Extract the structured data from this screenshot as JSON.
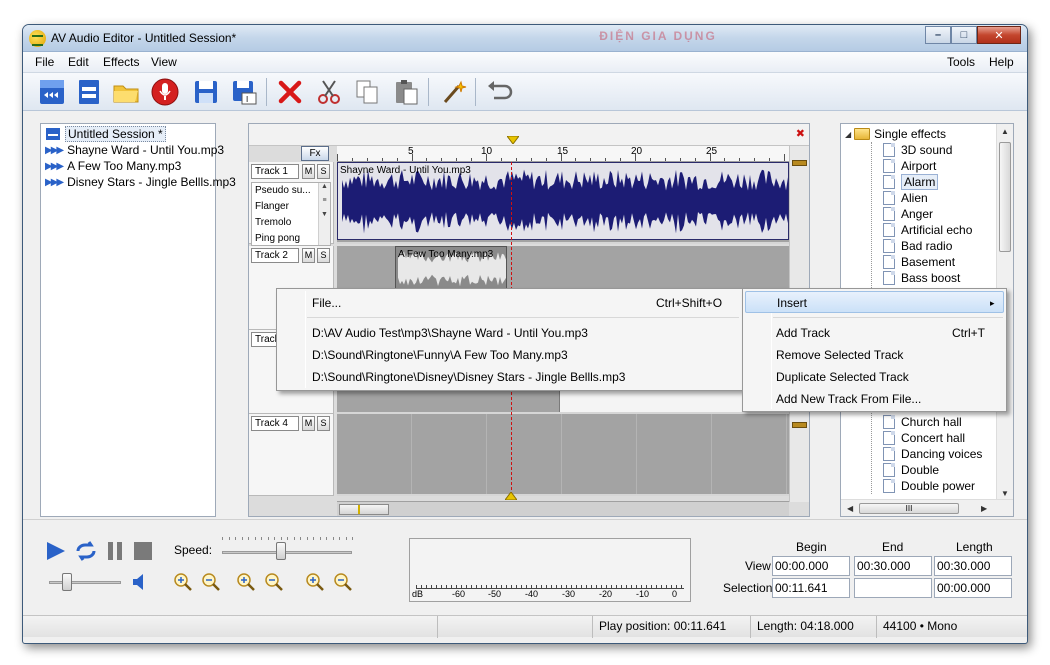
{
  "window": {
    "title": "AV Audio Editor - Untitled Session*",
    "watermark": "ĐIỆN GIA DỤNG",
    "controls": {
      "minimize": "–",
      "maximize": "□",
      "close": "✕"
    }
  },
  "menubar": {
    "left": [
      "File",
      "Edit",
      "Effects",
      "View"
    ],
    "right": [
      "Tools",
      "Help"
    ]
  },
  "toolbar": {
    "icons": [
      "new-session-icon",
      "new-file-icon",
      "open-folder-icon",
      "record-icon",
      "save-icon",
      "save-as-icon",
      "delete-icon",
      "cut-icon",
      "copy-icon",
      "paste-icon",
      "magic-wand-icon",
      "undo-icon"
    ]
  },
  "session": {
    "items": [
      {
        "label": "Untitled Session *",
        "type": "session"
      },
      {
        "label": "Shayne Ward -  Until You.mp3",
        "type": "file"
      },
      {
        "label": "A Few Too Many.mp3",
        "type": "file"
      },
      {
        "label": "Disney Stars - Jingle Bellls.mp3",
        "type": "file"
      }
    ]
  },
  "editor": {
    "fx_label": "Fx",
    "close_glyph": "✖",
    "ruler_ticks": [
      "5",
      "10",
      "15",
      "20",
      "25"
    ],
    "tracks": [
      {
        "label": "Track 1",
        "mute": "M",
        "solo": "S",
        "clip": "Shayne Ward -  Until You.mp3",
        "effects": [
          "Pseudo su...",
          "Flanger",
          "Tremolo",
          "Ping pong"
        ]
      },
      {
        "label": "Track 2",
        "mute": "M",
        "solo": "S",
        "clip": "A Few Too Many.mp3"
      },
      {
        "label": "Track",
        "mute": "M",
        "solo": "S",
        "clip": ""
      },
      {
        "label": "Track 4",
        "mute": "M",
        "solo": "S",
        "clip": ""
      }
    ]
  },
  "effects_tree": {
    "root": "Single effects",
    "items_top": [
      "3D sound",
      "Airport",
      "Alarm",
      "Alien",
      "Anger",
      "Artificial echo",
      "Bad radio",
      "Basement",
      "Bass boost"
    ],
    "selected": "Alarm",
    "items_bottom": [
      "Church hall",
      "Concert hall",
      "Dancing voices",
      "Double",
      "Double power"
    ],
    "h_thumb_glyph": "III"
  },
  "transport": {
    "speed_label": "Speed:",
    "speed_level": 0.45,
    "volume_level": 0.25,
    "zoom_icons": [
      "zoom-in-horizontal-icon",
      "zoom-out-horizontal-icon",
      "zoom-in-vertical-icon",
      "zoom-out-vertical-icon",
      "zoom-selection-icon",
      "zoom-fit-icon"
    ]
  },
  "meter": {
    "labels": [
      "dB",
      "-60",
      "-50",
      "-40",
      "-30",
      "-20",
      "-10",
      "0"
    ]
  },
  "time_display": {
    "headers": {
      "begin": "Begin",
      "end": "End",
      "length": "Length"
    },
    "view": {
      "label": "View",
      "begin": "00:00.000",
      "end": "00:30.000",
      "length": "00:30.000"
    },
    "selection": {
      "label": "Selection",
      "begin": "00:11.641",
      "end": "",
      "length": "00:00.000"
    }
  },
  "statusbar": {
    "play_position": "Play position: 00:11.641",
    "length": "Length: 04:18.000",
    "format": "44100 • Mono"
  },
  "context_menu_left": {
    "items": [
      {
        "label": "File...",
        "shortcut": "Ctrl+Shift+O"
      },
      {
        "label": "D:\\AV Audio Test\\mp3\\Shayne Ward -  Until You.mp3",
        "shortcut": ""
      },
      {
        "label": "D:\\Sound\\Ringtone\\Funny\\A Few Too Many.mp3",
        "shortcut": ""
      },
      {
        "label": "D:\\Sound\\Ringtone\\Disney\\Disney Stars - Jingle Bellls.mp3",
        "shortcut": ""
      }
    ]
  },
  "context_menu_right": {
    "items": [
      {
        "label": "Insert",
        "shortcut": "",
        "submenu": "▸"
      },
      {
        "label": "Add Track",
        "shortcut": "Ctrl+T"
      },
      {
        "label": "Remove Selected Track",
        "shortcut": ""
      },
      {
        "label": "Duplicate Selected Track",
        "shortcut": ""
      },
      {
        "label": "Add New Track From File...",
        "shortcut": ""
      }
    ]
  },
  "colors": {
    "waveform": "#1c1c74",
    "track_bg": "#a3a3a3",
    "menu_highlight": "#cbe1f8",
    "accent_blue": "#2a62c8"
  }
}
